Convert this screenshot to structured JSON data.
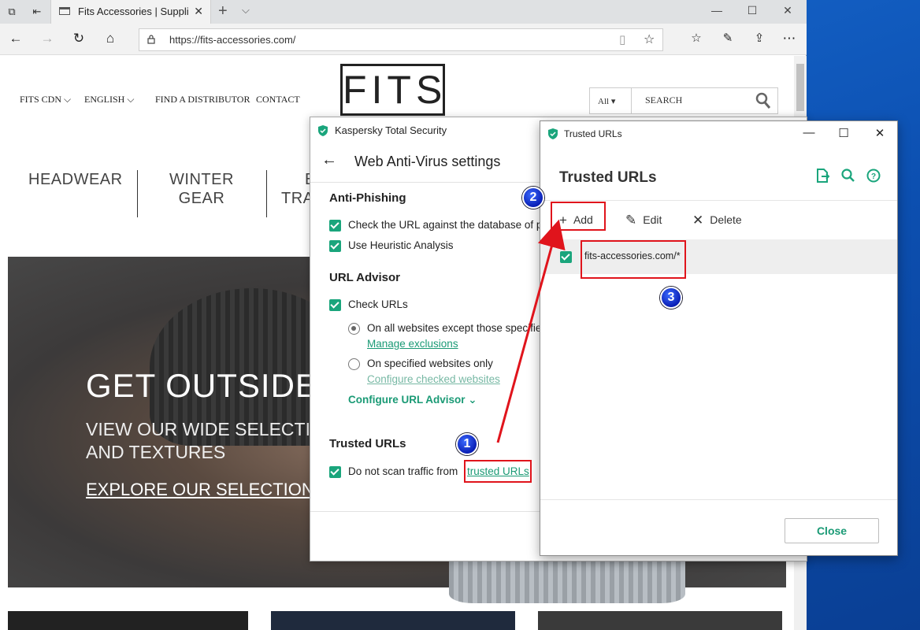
{
  "browser": {
    "tab_title": "Fits Accessories | Suppli",
    "url": "https://fits-accessories.com/"
  },
  "site": {
    "nav": [
      "FITS CDN",
      "ENGLISH",
      "FIND A DISTRIBUTOR",
      "CONTACT"
    ],
    "logo": "FITS",
    "search_scope": "All",
    "search_placeholder": "SEARCH",
    "categories": [
      {
        "line1": "HEADWEAR",
        "line2": ""
      },
      {
        "line1": "WINTER",
        "line2": "GEAR"
      },
      {
        "line1": "B",
        "line2": "TRA"
      }
    ],
    "hero": {
      "heading": "GET OUTSIDE",
      "sub1": "VIEW OUR WIDE SELECTIO",
      "sub2": "AND TEXTURES",
      "link": "EXPLORE OUR SELECTION"
    }
  },
  "kaspersky": {
    "window_title": "Kaspersky Total Security",
    "heading": "Web Anti-Virus settings",
    "anti_phishing": {
      "title": "Anti-Phishing",
      "opt1": "Check the URL against the database of p",
      "opt2": "Use Heuristic Analysis"
    },
    "url_advisor": {
      "title": "URL Advisor",
      "check_urls": "Check URLs",
      "radio1": "On all websites except those specifie",
      "radio1_link": "Manage exclusions",
      "radio2": "On specified websites only",
      "radio2_link": "Configure checked websites",
      "configure": "Configure URL Advisor"
    },
    "trusted": {
      "title": "Trusted URLs",
      "text": "Do not scan traffic from",
      "link": "trusted URLs"
    }
  },
  "trusted_dialog": {
    "window_title": "Trusted URLs",
    "heading": "Trusted URLs",
    "add": "Add",
    "edit": "Edit",
    "delete": "Delete",
    "rows": [
      "fits-accessories.com/*"
    ],
    "close": "Close"
  },
  "annotations": {
    "step1": "1",
    "step2": "2",
    "step3": "3"
  },
  "colors": {
    "kaspersky_green": "#1aa57c",
    "annotation_red": "#e0141c",
    "badge_blue": "#0a1fb5"
  }
}
